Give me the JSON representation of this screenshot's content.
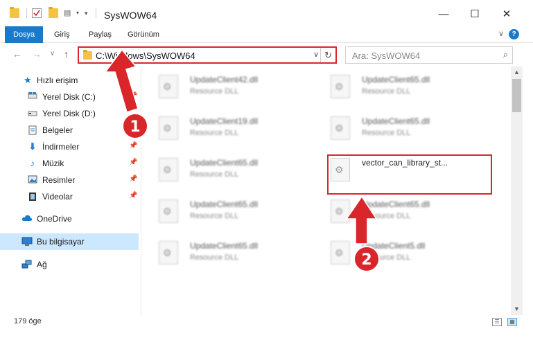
{
  "window": {
    "title": "SysWOW64",
    "minimize_glyph": "—",
    "maximize_glyph": "☐",
    "close_glyph": "✕"
  },
  "quick_access_toolbar": {
    "icons": [
      "folder-icon",
      "properties-icon",
      "new-folder-icon",
      "customize-icon",
      "dropdown-icon"
    ]
  },
  "ribbon": {
    "tabs": [
      {
        "label": "Dosya"
      },
      {
        "label": "Giriş"
      },
      {
        "label": "Paylaş"
      },
      {
        "label": "Görünüm"
      }
    ],
    "expand_glyph": "∨",
    "help_glyph": "?"
  },
  "navigation": {
    "back_glyph": "←",
    "forward_glyph": "→",
    "recent_glyph": "∨",
    "up_glyph": "↑",
    "address": "C:\\Windows\\SysWOW64",
    "address_dropdown_glyph": "∨",
    "refresh_glyph": "↻",
    "search_placeholder": "Ara: SysWOW64",
    "search_glyph": "⌕"
  },
  "sidebar": {
    "items": [
      {
        "label": "Hızlı erişim",
        "icon": "star-icon",
        "pinned": false
      },
      {
        "label": "Yerel Disk (C:)",
        "icon": "drive-c-icon",
        "pinned": true
      },
      {
        "label": "Yerel Disk (D:)",
        "icon": "drive-d-icon",
        "pinned": true
      },
      {
        "label": "Belgeler",
        "icon": "documents-icon",
        "pinned": true
      },
      {
        "label": "İndirmeler",
        "icon": "downloads-icon",
        "pinned": true
      },
      {
        "label": "Müzik",
        "icon": "music-icon",
        "pinned": true
      },
      {
        "label": "Resimler",
        "icon": "pictures-icon",
        "pinned": true
      },
      {
        "label": "Videolar",
        "icon": "videos-icon",
        "pinned": true
      },
      {
        "label": "OneDrive",
        "icon": "cloud-icon",
        "pinned": false
      },
      {
        "label": "Bu bilgisayar",
        "icon": "computer-icon",
        "pinned": false,
        "selected": true
      },
      {
        "label": "Ağ",
        "icon": "network-icon",
        "pinned": false
      }
    ],
    "pin_glyph": "📌"
  },
  "files": [
    {
      "name": "UpdateClient42.dll",
      "type": "Resource DLL"
    },
    {
      "name": "UpdateClient65.dll",
      "type": "Resource DLL"
    },
    {
      "name": "UpdateClient19.dll",
      "type": "Resource DLL"
    },
    {
      "name": "UpdateClient65.dll",
      "type": "Resource DLL"
    },
    {
      "name": "UpdateClient65.dll",
      "type": "Resource DLL"
    },
    {
      "name": "vector_can_library_st...",
      "type": ""
    },
    {
      "name": "UpdateClient65.dll",
      "type": "Resource DLL"
    },
    {
      "name": "UpdateClient65.dll",
      "type": "Resource DLL"
    },
    {
      "name": "UpdateClient65.dll",
      "type": "Resource DLL"
    },
    {
      "name": "UpdateClient5.dll",
      "type": "Resource DLL"
    }
  ],
  "annotations": {
    "callout_1": "1",
    "callout_2": "2",
    "accent_color": "#d9262b"
  },
  "scrollbar": {
    "up_glyph": "▲",
    "down_glyph": "▼"
  },
  "status": {
    "item_count": "179 öge",
    "details_view_glyph": "☰",
    "tiles_view_glyph": "▦"
  },
  "colors": {
    "ribbon_active": "#1979ca",
    "selection": "#cce8ff",
    "highlight": "#d9262b"
  }
}
